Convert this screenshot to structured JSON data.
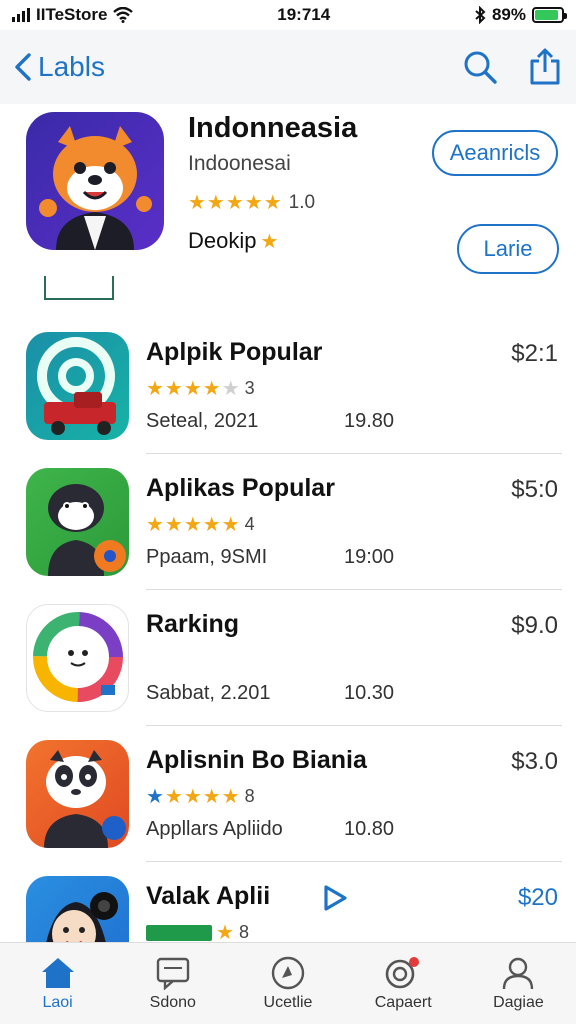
{
  "status": {
    "carrier": "IITeStore",
    "time": "19:714",
    "battery": "89%",
    "battery_level": 0.89
  },
  "nav": {
    "back_label": "Labls"
  },
  "featured": {
    "title": "Indonneasia",
    "subtitle": "Indoonesai",
    "rating": "1.0",
    "extra": "Deokip",
    "button_primary": "Aeanricls",
    "button_secondary": "Larie"
  },
  "apps": [
    {
      "title": "Aplpik Popular",
      "price": "$2:1",
      "rating": "3",
      "meta": "Seteal, 2021",
      "meta2": "19.80"
    },
    {
      "title": "Aplikas Popular",
      "price": "$5:0",
      "rating": "4",
      "meta": "Ppaam, 9SMI",
      "meta2": "19:00"
    },
    {
      "title": "Rarking",
      "price": "$9.0",
      "rating": "",
      "meta": "Sabbat, 2.201",
      "meta2": "10.30"
    },
    {
      "title": "Aplisnin Bo  Biania",
      "price": "$3.0",
      "rating": "8",
      "meta": "Appllars Apliido",
      "meta2": "10.80"
    },
    {
      "title": "Valak Aplii",
      "price": "$20",
      "rating": "8",
      "meta": "",
      "meta2": ""
    }
  ],
  "tabs": [
    {
      "label": "Laoi",
      "icon": "home-icon"
    },
    {
      "label": "Sdono",
      "icon": "chat-icon"
    },
    {
      "label": "Ucetlie",
      "icon": "compass-icon"
    },
    {
      "label": "Capaert",
      "icon": "search-badge-icon"
    },
    {
      "label": "Dagiae",
      "icon": "profile-icon"
    }
  ],
  "colors": {
    "accent": "#1e73c8",
    "star": "#f3a712",
    "battery": "#34c759"
  }
}
